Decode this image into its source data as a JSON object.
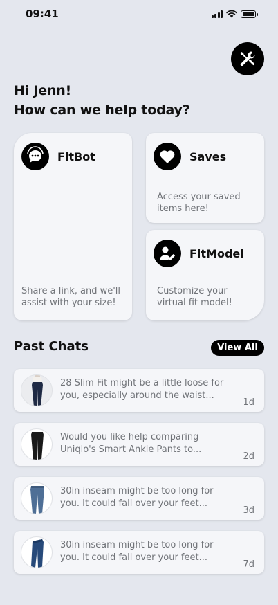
{
  "status_bar": {
    "time": "09:41"
  },
  "greeting": {
    "line1": "Hi Jenn!",
    "line2": "How can we help today?"
  },
  "cards": {
    "fitbot": {
      "title": "FitBot",
      "description": "Share a link, and we'll assist with your size!",
      "icon": "chat-bubble-icon"
    },
    "saves": {
      "title": "Saves",
      "description": "Access your saved items here!",
      "icon": "heart-icon"
    },
    "fitmodel": {
      "title": "FitModel",
      "description": "Customize your virtual fit model!",
      "icon": "user-edit-icon"
    }
  },
  "past_chats": {
    "title": "Past Chats",
    "view_all_label": "View All",
    "items": [
      {
        "text": "28 Slim Fit might be a little loose for you, especially around the waist...",
        "time": "1d",
        "thumb": "jeans-on-model"
      },
      {
        "text": "Would you like help comparing Uniqlo's Smart Ankle Pants to...",
        "time": "2d",
        "thumb": "black-pants"
      },
      {
        "text": "30in inseam might be too long for you. It could fall over your feet...",
        "time": "3d",
        "thumb": "light-jeans"
      },
      {
        "text": "30in inseam might be too long for you. It could fall over your feet...",
        "time": "7d",
        "thumb": "dark-jeans"
      }
    ]
  },
  "colors": {
    "background": "#e4e7ee",
    "card": "#f5f6f9",
    "accent": "#000000",
    "muted_text": "#707378"
  }
}
